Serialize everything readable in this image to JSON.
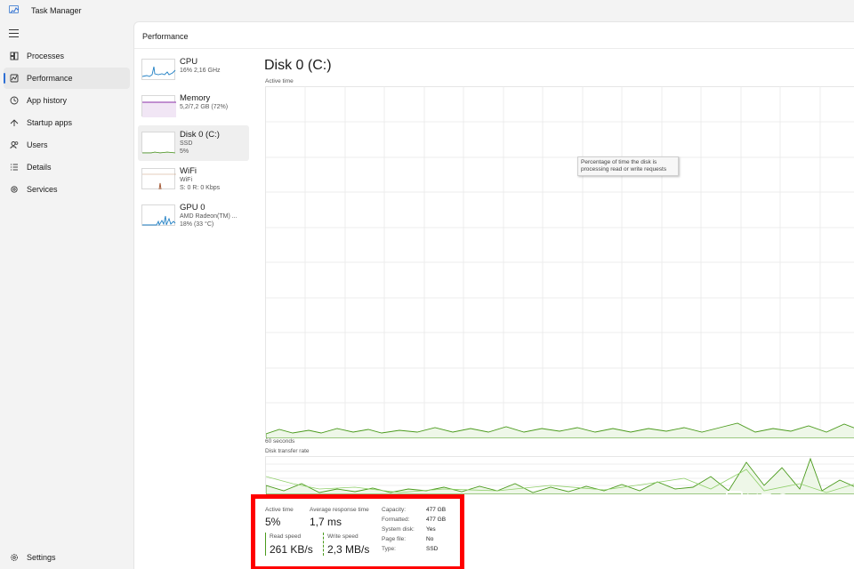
{
  "app": {
    "title": "Task Manager"
  },
  "nav": {
    "items": [
      {
        "label": "Processes",
        "icon": "processes-icon"
      },
      {
        "label": "Performance",
        "icon": "performance-icon",
        "active": true
      },
      {
        "label": "App history",
        "icon": "app-history-icon"
      },
      {
        "label": "Startup apps",
        "icon": "startup-apps-icon"
      },
      {
        "label": "Users",
        "icon": "users-icon"
      },
      {
        "label": "Details",
        "icon": "details-icon"
      },
      {
        "label": "Services",
        "icon": "services-icon"
      }
    ],
    "settings": {
      "label": "Settings",
      "icon": "gear-icon"
    }
  },
  "page": {
    "title": "Performance"
  },
  "devices": [
    {
      "name": "CPU",
      "lines": [
        "16% 2,16 GHz"
      ],
      "color": "#1f7fc4"
    },
    {
      "name": "Memory",
      "lines": [
        "5,2/7,2 GB (72%)"
      ],
      "color": "#8b2fa8"
    },
    {
      "name": "Disk 0 (C:)",
      "lines": [
        "SSD",
        "5%"
      ],
      "color": "#4a9a1c",
      "selected": true
    },
    {
      "name": "WiFi",
      "lines": [
        "WiFi",
        "S: 0 R: 0 Kbps"
      ],
      "color": "#a0522d"
    },
    {
      "name": "GPU 0",
      "lines": [
        "AMD Radeon(TM) ...",
        "18% (33 °C)"
      ],
      "color": "#1f7fc4"
    }
  ],
  "disk": {
    "title": "Disk 0 (C:)",
    "active_time_label": "Active time",
    "seconds_label": "60 seconds",
    "transfer_rate_label": "Disk transfer rate",
    "tooltip": [
      "Percentage of time the disk is",
      "processing read or write requests"
    ],
    "graph_color": "#4a9a1c"
  },
  "stats": {
    "active_time": {
      "label": "Active time",
      "value": "5%"
    },
    "response_time": {
      "label": "Average response time",
      "value": "1,7 ms"
    },
    "read_speed": {
      "label": "Read speed",
      "value": "261 KB/s"
    },
    "write_speed": {
      "label": "Write speed",
      "value": "2,3 MB/s"
    },
    "properties": [
      {
        "key": "Capacity:",
        "value": "477 GB"
      },
      {
        "key": "Formatted:",
        "value": "477 GB"
      },
      {
        "key": "System disk:",
        "value": "Yes"
      },
      {
        "key": "Page file:",
        "value": "No"
      },
      {
        "key": "Type:",
        "value": "SSD"
      }
    ]
  },
  "watermark": {
    "logo": "xda-logo-icon"
  }
}
